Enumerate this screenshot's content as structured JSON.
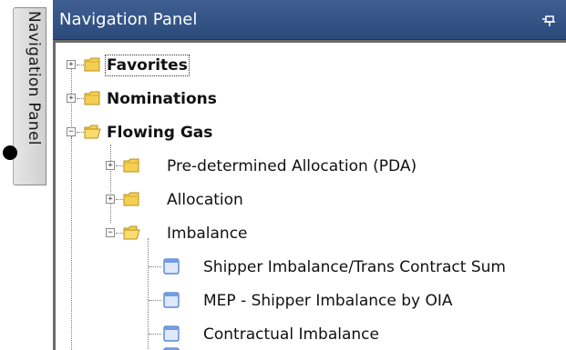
{
  "dock": {
    "tab_label": "Navigation Panel"
  },
  "panel": {
    "title": "Navigation Panel",
    "pin_icon": "pin-icon"
  },
  "tree": {
    "favorites": {
      "label": "Favorites",
      "expander": "+"
    },
    "nominations": {
      "label": "Nominations",
      "expander": "+"
    },
    "flowing_gas": {
      "label": "Flowing Gas",
      "expander": "−",
      "children": {
        "pda": {
          "label": "Pre-determined Allocation (PDA)",
          "expander": "+"
        },
        "allocation": {
          "label": "Allocation",
          "expander": "+"
        },
        "imbalance": {
          "label": "Imbalance",
          "expander": "−",
          "items": [
            {
              "label": "Shipper Imbalance/Trans Contract Sum"
            },
            {
              "label": "MEP - Shipper Imbalance by OIA"
            },
            {
              "label": "Contractual Imbalance"
            }
          ]
        }
      }
    }
  },
  "colors": {
    "header_bg": "#2f4f85",
    "folder": "#f2c94c",
    "doc_blue": "#4a7fd4"
  }
}
